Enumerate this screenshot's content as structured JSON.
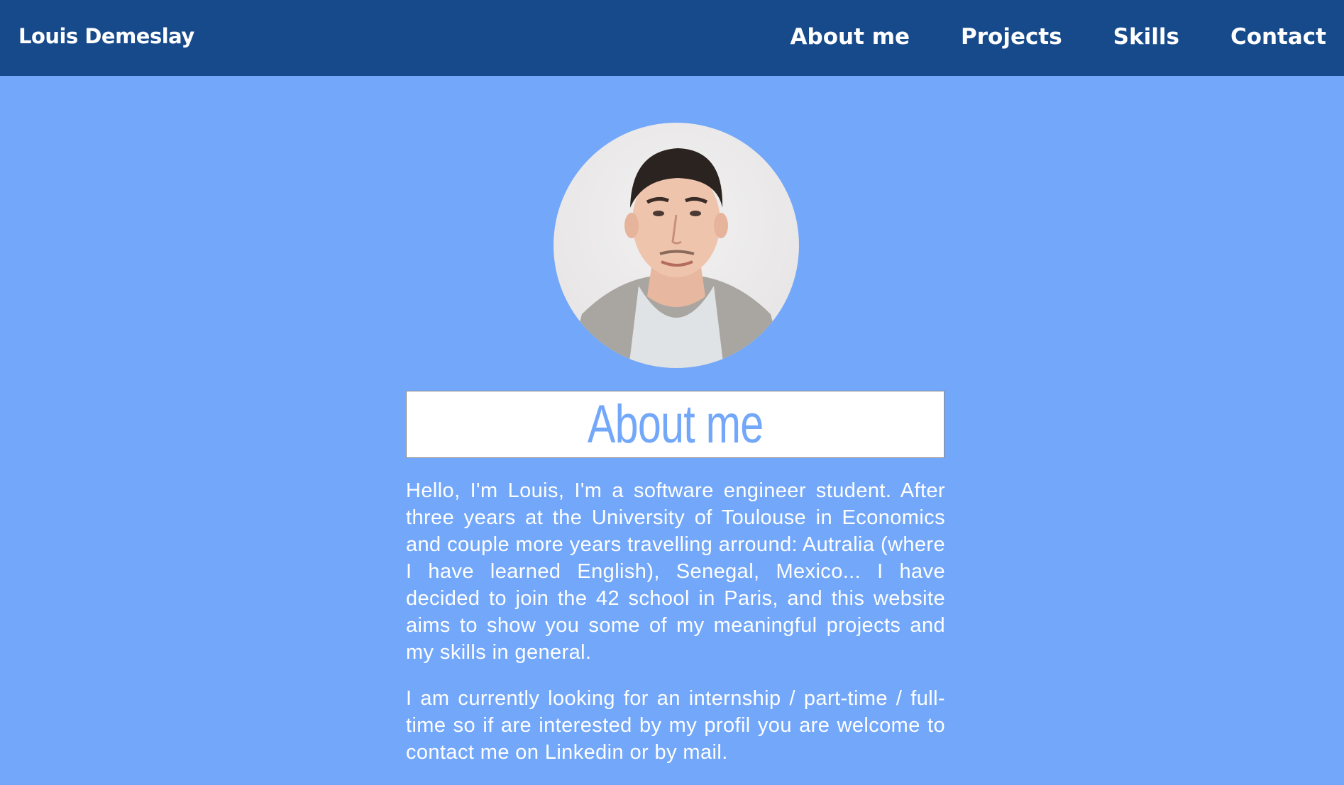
{
  "header": {
    "brand": "Louis Demeslay",
    "nav": [
      {
        "label": "About me"
      },
      {
        "label": "Projects"
      },
      {
        "label": "Skills"
      },
      {
        "label": "Contact"
      }
    ]
  },
  "about": {
    "title": "About me",
    "paragraphs": [
      "Hello, I'm Louis, I'm a software engineer student. After three years at the University of Toulouse in Economics and couple more years travelling arround: Autralia (where I have learned English), Senegal, Mexico... I have decided to join the 42 school in Paris, and this website aims to show you some of my meaningful projects and my skills in general.",
      "I am currently looking for an internship / part-time / full-time so if are interested by my profil you are welcome to contact me on Linkedin or by mail."
    ]
  },
  "colors": {
    "background": "#72a7fa",
    "header": "#174a8b",
    "title_text": "#72a7fa"
  },
  "icons": {
    "avatar": "profile-photo"
  }
}
